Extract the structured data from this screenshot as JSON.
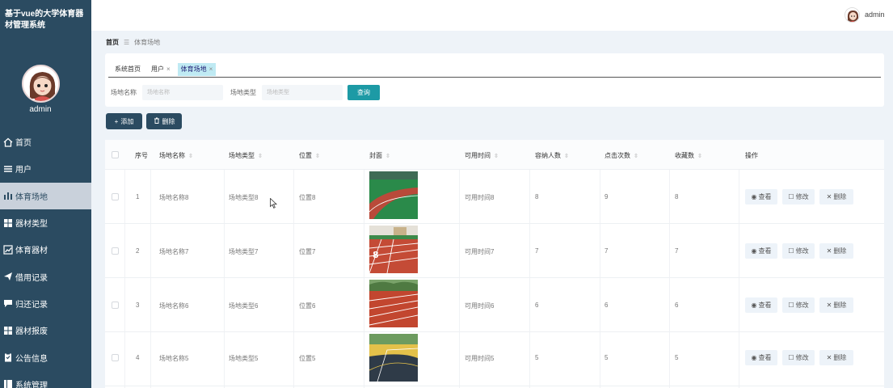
{
  "app": {
    "title": "基于vue的大学体育器材管理系统",
    "username": "admin"
  },
  "header": {
    "username": "admin"
  },
  "sidebar": {
    "items": [
      {
        "label": "首页",
        "icon": "home-icon"
      },
      {
        "label": "用户",
        "icon": "list-icon"
      },
      {
        "label": "体育场地",
        "icon": "bar-chart-icon"
      },
      {
        "label": "器材类型",
        "icon": "grid-icon"
      },
      {
        "label": "体育器材",
        "icon": "line-chart-icon"
      },
      {
        "label": "借用记录",
        "icon": "send-icon"
      },
      {
        "label": "归还记录",
        "icon": "comment-icon"
      },
      {
        "label": "器材报废",
        "icon": "grid-icon"
      },
      {
        "label": "公告信息",
        "icon": "clipboard-icon"
      },
      {
        "label": "系统管理",
        "icon": "book-icon"
      }
    ]
  },
  "breadcrumb": {
    "home": "首页",
    "sep": "☰",
    "current": "体育场地"
  },
  "tabs": [
    {
      "label": "系统首页",
      "closable": ""
    },
    {
      "label": "用户",
      "closable": "×"
    },
    {
      "label": "体育场地",
      "closable": "×"
    }
  ],
  "search": {
    "name_label": "场地名称",
    "name_placeholder": "场地名称",
    "type_label": "场地类型",
    "type_placeholder": "场地类型",
    "button": "查询"
  },
  "actions": {
    "add": "添加",
    "delete": "删除"
  },
  "table": {
    "columns": [
      "序号",
      "场地名称",
      "场地类型",
      "位置",
      "封面",
      "可用时间",
      "容纳人数",
      "点击次数",
      "收藏数",
      "操作"
    ],
    "rows": [
      {
        "index": "1",
        "name": "场地名称8",
        "type": "场地类型8",
        "location": "位置8",
        "time": "可用时间8",
        "capacity": "8",
        "clicks": "9",
        "favorites": "8"
      },
      {
        "index": "2",
        "name": "场地名称7",
        "type": "场地类型7",
        "location": "位置7",
        "time": "可用时间7",
        "capacity": "7",
        "clicks": "7",
        "favorites": "7"
      },
      {
        "index": "3",
        "name": "场地名称6",
        "type": "场地类型6",
        "location": "位置6",
        "time": "可用时间6",
        "capacity": "6",
        "clicks": "6",
        "favorites": "6"
      },
      {
        "index": "4",
        "name": "场地名称5",
        "type": "场地类型5",
        "location": "位置5",
        "time": "可用时间5",
        "capacity": "5",
        "clicks": "5",
        "favorites": "5"
      }
    ],
    "ops": {
      "view": "查看",
      "edit": "修改",
      "delete": "删除"
    }
  }
}
